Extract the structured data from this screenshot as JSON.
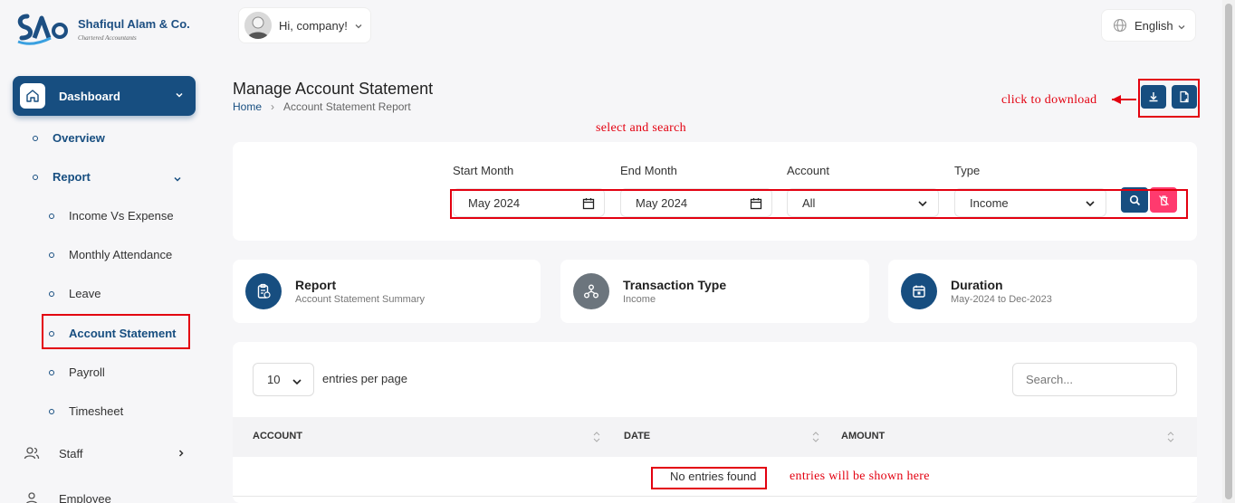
{
  "brand": {
    "name": "Shafiqul Alam & Co.",
    "subtitle": "Chartered Accountants"
  },
  "sidebar": {
    "dashboard": "Dashboard",
    "overview": "Overview",
    "report": "Report",
    "report_items": [
      "Income Vs Expense",
      "Monthly Attendance",
      "Leave",
      "Account Statement",
      "Payroll",
      "Timesheet"
    ],
    "staff": "Staff",
    "employee": "Employee"
  },
  "header": {
    "greeting": "Hi, company!",
    "language": "English"
  },
  "page": {
    "title": "Manage Account Statement",
    "breadcrumb": [
      "Home",
      "Account Statement Report"
    ]
  },
  "annotations": {
    "download": "click to download",
    "search": "select and search",
    "entries": "entries will be shown here"
  },
  "filters": {
    "start_label": "Start Month",
    "start_value": "May 2024",
    "end_label": "End Month",
    "end_value": "May 2024",
    "account_label": "Account",
    "account_value": "All",
    "type_label": "Type",
    "type_value": "Income"
  },
  "info_cards": [
    {
      "title": "Report",
      "subtitle": "Account Statement Summary",
      "icon": "clipboard-report-icon",
      "color": "#174e80"
    },
    {
      "title": "Transaction Type",
      "subtitle": "Income",
      "icon": "hierarchy-icon",
      "color": "#6c757d"
    },
    {
      "title": "Duration",
      "subtitle": "May-2024 to Dec-2023",
      "icon": "calendar-icon",
      "color": "#174e80"
    }
  ],
  "table": {
    "per_page_value": "10",
    "per_page_label": "entries per page",
    "search_placeholder": "Search...",
    "columns": [
      "ACCOUNT",
      "DATE",
      "AMOUNT"
    ],
    "empty_text": "No entries found"
  },
  "colors": {
    "primary": "#174e80",
    "danger": "#ff3a6e",
    "annotation": "#e30010"
  }
}
